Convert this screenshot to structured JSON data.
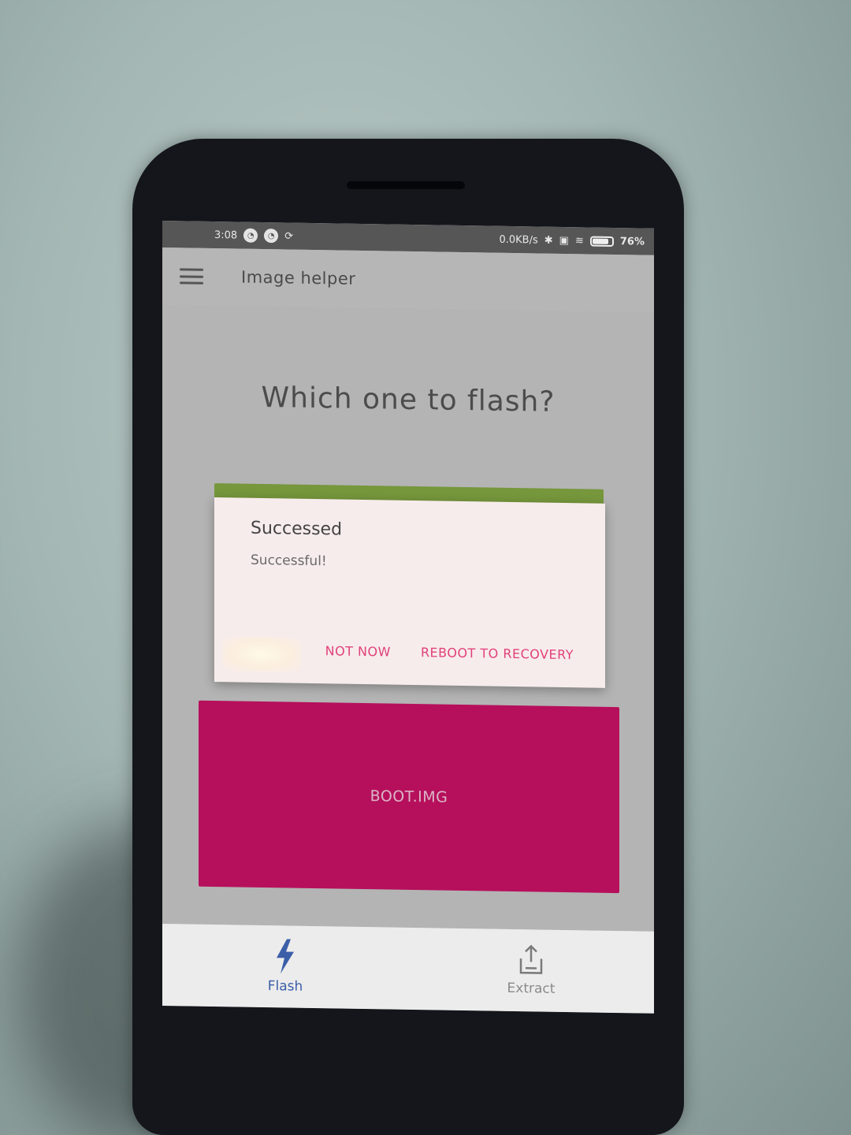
{
  "status_bar": {
    "time": "3:08",
    "network_speed": "0.0KB/s",
    "battery": "76%"
  },
  "app_bar": {
    "title": "Image helper",
    "menu_icon": "hamburger-menu-icon"
  },
  "main": {
    "question": "Which one to flash?",
    "cards": [
      {
        "label": "",
        "color": "#7da23b"
      },
      {
        "label": "BOOT.IMG",
        "color": "#c5085f"
      }
    ]
  },
  "dialog": {
    "title": "Successed",
    "message": "Successful!",
    "actions": {
      "not_now": "NOT NOW",
      "reboot": "REBOOT TO RECOVERY"
    },
    "accent_color": "#e0407a"
  },
  "bottom_nav": {
    "items": [
      {
        "label": "Flash",
        "icon": "lightning-icon",
        "active": true
      },
      {
        "label": "Extract",
        "icon": "upload-tray-icon",
        "active": false
      }
    ]
  }
}
